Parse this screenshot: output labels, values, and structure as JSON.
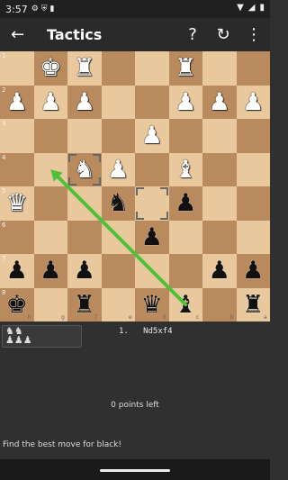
{
  "status": {
    "time": "3:57",
    "left_icons": [
      "settings-icon",
      "shield-icon",
      "sim-icon"
    ],
    "right_icons": [
      "wifi-icon",
      "signal-icon",
      "battery-icon"
    ]
  },
  "app_bar": {
    "title": "Tactics",
    "back_icon": "←",
    "help_icon": "?",
    "retry_icon": "↻",
    "more_icon": "⋮"
  },
  "board": {
    "rank_labels": [
      "1",
      "2",
      "3",
      "4",
      "5",
      "6",
      "7",
      "8"
    ],
    "file_labels": [
      "h",
      "g",
      "f",
      "e",
      "d",
      "c",
      "b",
      "a"
    ],
    "orientation": "black-bottom",
    "light_color": "#e9c89d",
    "dark_color": "#b98a5e",
    "arrow_color": "#4cc23a",
    "pieces": [
      {
        "sq": "g1",
        "color": "w",
        "glyph": "♚",
        "name": "white-king"
      },
      {
        "sq": "f1",
        "color": "w",
        "glyph": "♜",
        "name": "white-rook"
      },
      {
        "sq": "c1",
        "color": "w",
        "glyph": "♜",
        "name": "white-rook"
      },
      {
        "sq": "h2",
        "color": "w",
        "glyph": "♟",
        "name": "white-pawn"
      },
      {
        "sq": "g2",
        "color": "w",
        "glyph": "♟",
        "name": "white-pawn"
      },
      {
        "sq": "f2",
        "color": "w",
        "glyph": "♟",
        "name": "white-pawn"
      },
      {
        "sq": "c2",
        "color": "w",
        "glyph": "♟",
        "name": "white-pawn"
      },
      {
        "sq": "b2",
        "color": "w",
        "glyph": "♟",
        "name": "white-pawn"
      },
      {
        "sq": "a2",
        "color": "w",
        "glyph": "♟",
        "name": "white-pawn"
      },
      {
        "sq": "d3",
        "color": "w",
        "glyph": "♟",
        "name": "white-pawn"
      },
      {
        "sq": "f4",
        "color": "w",
        "glyph": "♞",
        "name": "white-knight"
      },
      {
        "sq": "e4",
        "color": "w",
        "glyph": "♟",
        "name": "white-pawn"
      },
      {
        "sq": "c4",
        "color": "w",
        "glyph": "♝",
        "name": "white-bishop"
      },
      {
        "sq": "h5",
        "color": "w",
        "glyph": "♛",
        "name": "white-queen"
      },
      {
        "sq": "e5",
        "color": "b",
        "glyph": "♞",
        "name": "black-knight"
      },
      {
        "sq": "c5",
        "color": "b",
        "glyph": "♟",
        "name": "black-pawn"
      },
      {
        "sq": "d6",
        "color": "b",
        "glyph": "♟",
        "name": "black-pawn"
      },
      {
        "sq": "h7",
        "color": "b",
        "glyph": "♟",
        "name": "black-pawn"
      },
      {
        "sq": "g7",
        "color": "b",
        "glyph": "♟",
        "name": "black-pawn"
      },
      {
        "sq": "f7",
        "color": "b",
        "glyph": "♟",
        "name": "black-pawn"
      },
      {
        "sq": "b7",
        "color": "b",
        "glyph": "♟",
        "name": "black-pawn"
      },
      {
        "sq": "a7",
        "color": "b",
        "glyph": "♟",
        "name": "black-pawn"
      },
      {
        "sq": "h8",
        "color": "b",
        "glyph": "♚",
        "name": "black-king"
      },
      {
        "sq": "f8",
        "color": "b",
        "glyph": "♜",
        "name": "black-rook"
      },
      {
        "sq": "d8",
        "color": "b",
        "glyph": "♛",
        "name": "black-queen"
      },
      {
        "sq": "c8",
        "color": "b",
        "glyph": "♝",
        "name": "black-bishop"
      },
      {
        "sq": "a8",
        "color": "b",
        "glyph": "♜",
        "name": "black-rook"
      }
    ],
    "last_move": {
      "from": "d5",
      "to": "f4"
    },
    "hint_arrow": {
      "from": "c8",
      "to": "g4"
    }
  },
  "captured_panel": {
    "pieces": "♞♞\n♟♟♟"
  },
  "moves": {
    "text": "1.   Nd5xf4"
  },
  "points_text": "0 points left",
  "prompt_text": "Find the best move for black!"
}
